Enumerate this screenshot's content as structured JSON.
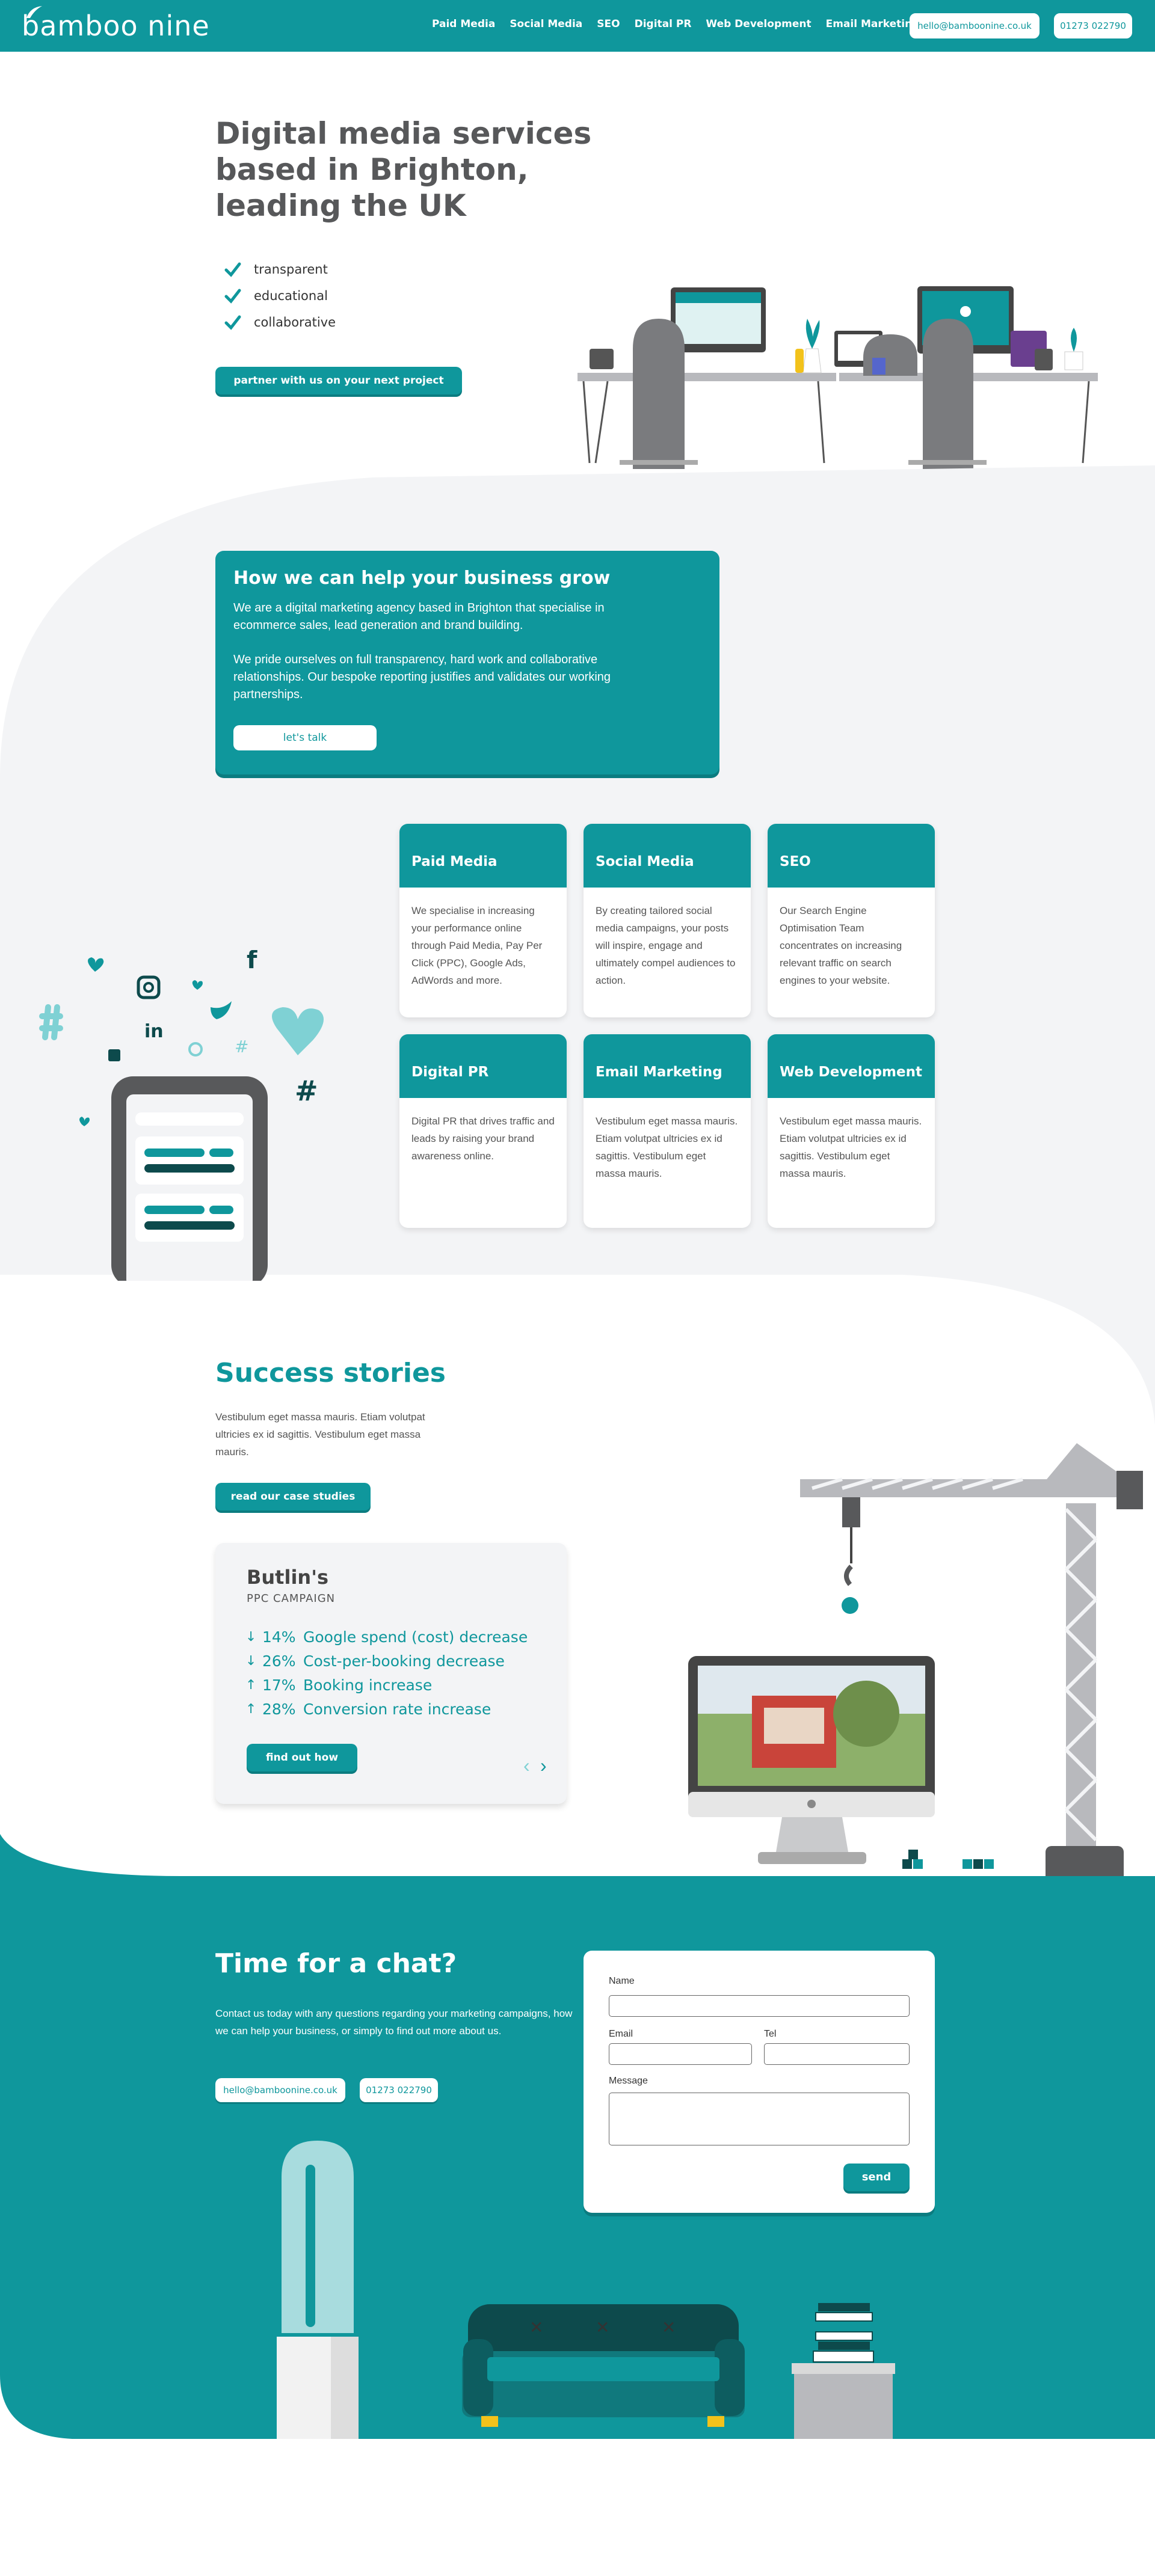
{
  "header": {
    "logo": "bamboo nine",
    "nav": [
      "Paid Media",
      "Social Media",
      "SEO",
      "Digital PR",
      "Web Development",
      "Email Marketing"
    ],
    "email": "hello@bamboonine.co.uk",
    "phone": "01273 022790"
  },
  "hero": {
    "title": "Digital media services based in Brighton, leading the UK",
    "checks": [
      "transparent",
      "educational",
      "collaborative"
    ],
    "cta": "partner with us on your next project"
  },
  "help": {
    "title": "How we can help your business grow",
    "p1": "We are a digital marketing agency based in Brighton that specialise in ecommerce sales, lead generation and brand building.",
    "p2": "We pride ourselves on full transparency, hard work and collaborative relationships. Our bespoke reporting justifies and validates our working partnerships.",
    "cta": "let's talk"
  },
  "services": [
    {
      "title": "Paid Media",
      "text": "We specialise in increasing your performance online through Paid Media, Pay Per Click (PPC), Google Ads, AdWords and more."
    },
    {
      "title": "Social Media",
      "text": "By creating tailored social media campaigns, your posts will inspire, engage and ultimately compel audiences to action."
    },
    {
      "title": "SEO",
      "text": "Our Search Engine Optimisation Team concentrates on increasing relevant traffic on search engines to your website."
    },
    {
      "title": "Digital PR",
      "text": "Digital PR that drives traffic and leads by raising your brand awareness online."
    },
    {
      "title": "Email Marketing",
      "text": "Vestibulum eget massa mauris. Etiam volutpat ultricies ex id sagittis. Vestibulum eget massa mauris."
    },
    {
      "title": "Web Development",
      "text": "Vestibulum eget massa mauris. Etiam volutpat ultricies ex id sagittis. Vestibulum eget massa mauris."
    }
  ],
  "success": {
    "title": "Success stories",
    "text": "Vestibulum eget massa mauris. Etiam volutpat ultricies ex id sagittis. Vestibulum eget massa mauris.",
    "cta": "read our case studies",
    "case": {
      "title": "Butlin's",
      "subtitle": "PPC CAMPAIGN",
      "stats": [
        {
          "arrow": "↓",
          "pct": "14%",
          "label": "Google spend (cost) decrease"
        },
        {
          "arrow": "↓",
          "pct": "26%",
          "label": "Cost-per-booking decrease"
        },
        {
          "arrow": "↑",
          "pct": "17%",
          "label": "Booking increase"
        },
        {
          "arrow": "↑",
          "pct": "28%",
          "label": "Conversion rate increase"
        }
      ],
      "cta": "find out how",
      "prev": "‹",
      "next": "›"
    }
  },
  "chat": {
    "title": "Time for a chat?",
    "text": "Contact us today with any questions regarding your marketing campaigns, how we can help your business, or simply to find out more about us.",
    "email": "hello@bamboonine.co.uk",
    "phone": "01273 022790",
    "form": {
      "name_label": "Name",
      "email_label": "Email",
      "tel_label": "Tel",
      "message_label": "Message",
      "send": "send"
    }
  },
  "colors": {
    "brand": "#0f979c",
    "grey_bg": "#f3f4f6",
    "dark_text": "#57585a"
  }
}
